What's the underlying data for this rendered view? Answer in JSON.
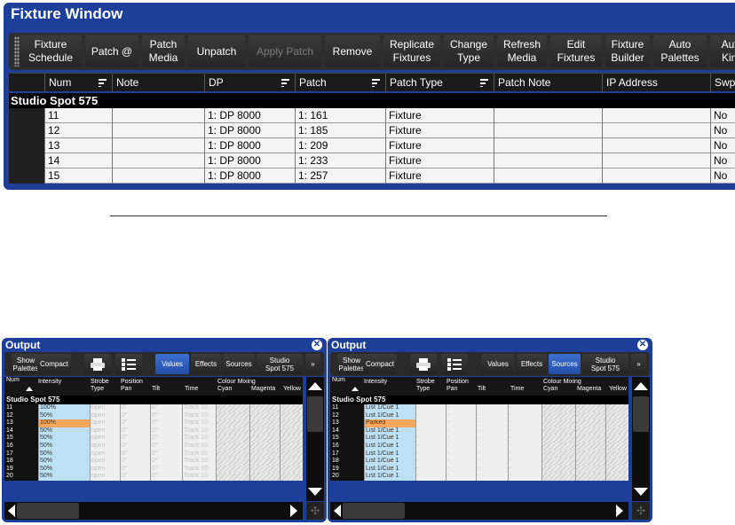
{
  "fixture_window": {
    "title": "Fixture Window",
    "toolbar": [
      {
        "label": "Fixture\nSchedule",
        "enabled": true
      },
      {
        "label": "Patch @",
        "enabled": true
      },
      {
        "label": "Patch\nMedia",
        "enabled": true
      },
      {
        "label": "Unpatch",
        "enabled": true
      },
      {
        "label": "Apply Patch",
        "enabled": false
      },
      {
        "label": "Remove",
        "enabled": true
      },
      {
        "label": "Replicate\nFixtures",
        "enabled": true
      },
      {
        "label": "Change\nType",
        "enabled": true
      },
      {
        "label": "Refresh\nMedia",
        "enabled": true
      },
      {
        "label": "Edit\nFixtures",
        "enabled": true
      },
      {
        "label": "Fixture\nBuilder",
        "enabled": true
      },
      {
        "label": "Auto\nPalettes",
        "enabled": true
      },
      {
        "label": "Auto\nKind",
        "enabled": true
      }
    ],
    "columns": [
      "Num",
      "Note",
      "DP",
      "Patch",
      "Patch Type",
      "Patch Note",
      "IP Address",
      "Swp"
    ],
    "group": "Studio Spot 575",
    "rows": [
      [
        "11",
        "",
        "1: DP 8000",
        "1: 161",
        "Fixture",
        "",
        "",
        "No"
      ],
      [
        "12",
        "",
        "1: DP 8000",
        "1: 185",
        "Fixture",
        "",
        "",
        "No"
      ],
      [
        "13",
        "",
        "1: DP 8000",
        "1: 209",
        "Fixture",
        "",
        "",
        "No"
      ],
      [
        "14",
        "",
        "1: DP 8000",
        "1: 233",
        "Fixture",
        "",
        "",
        "No"
      ],
      [
        "15",
        "",
        "1: DP 8000",
        "1: 257",
        "Fixture",
        "",
        "",
        "No"
      ]
    ]
  },
  "output_windows": [
    {
      "title": "Output",
      "toolbar": [
        "Show\nPalettes",
        "Compact",
        "",
        "",
        "Values",
        "Effects",
        "Sources",
        "Studio\nSpot 575",
        "»"
      ],
      "active_tab": "Values",
      "headers": [
        "Num",
        "Intensity",
        "Strobe\nType",
        "Position\nPan",
        "Tilt",
        "Time",
        "Colour Mixing\nCyan",
        "Magenta",
        "Yellow"
      ],
      "group": "Studio Spot 575",
      "rows": [
        {
          "num": "11",
          "value": "100%",
          "highlight": false
        },
        {
          "num": "12",
          "value": "50%",
          "highlight": false
        },
        {
          "num": "13",
          "value": "100%",
          "highlight": true
        },
        {
          "num": "14",
          "value": "50%",
          "highlight": false
        },
        {
          "num": "15",
          "value": "50%",
          "highlight": false
        },
        {
          "num": "16",
          "value": "50%",
          "highlight": false
        },
        {
          "num": "17",
          "value": "50%",
          "highlight": false
        },
        {
          "num": "18",
          "value": "50%",
          "highlight": false
        },
        {
          "num": "19",
          "value": "50%",
          "highlight": false
        },
        {
          "num": "20",
          "value": "50%",
          "highlight": false
        }
      ],
      "dim_cells": [
        "open",
        "0°",
        "0°",
        "Track 10"
      ]
    },
    {
      "title": "Output",
      "toolbar": [
        "Show\nPalettes",
        "Compact",
        "",
        "",
        "Values",
        "Effects",
        "Sources",
        "Studio\nSpot 575",
        "»"
      ],
      "active_tab": "Sources",
      "headers": [
        "Num",
        "Intensity",
        "Strobe\nType",
        "Position\nPan",
        "Tilt",
        "Time",
        "Colour Mixing\nCyan",
        "Magenta",
        "Yellow"
      ],
      "group": "Studio Spot 575",
      "rows": [
        {
          "num": "11",
          "value": "List 1/Cue 1",
          "highlight": false
        },
        {
          "num": "12",
          "value": "List 1/Cue 1",
          "highlight": false
        },
        {
          "num": "13",
          "value": "Parked",
          "highlight": true
        },
        {
          "num": "14",
          "value": "List 1/Cue 1",
          "highlight": false
        },
        {
          "num": "15",
          "value": "List 1/Cue 1",
          "highlight": false
        },
        {
          "num": "16",
          "value": "List 1/Cue 1",
          "highlight": false
        },
        {
          "num": "17",
          "value": "List 1/Cue 1",
          "highlight": false
        },
        {
          "num": "18",
          "value": "List 1/Cue 1",
          "highlight": false
        },
        {
          "num": "19",
          "value": "List 1/Cue 1",
          "highlight": false
        },
        {
          "num": "20",
          "value": "List 1/Cue 1",
          "highlight": false
        }
      ],
      "dim_cells": [
        "-",
        "-",
        "-",
        "-"
      ]
    }
  ],
  "colors": {
    "window_blue": "#1d3f9a",
    "active_tab": "#2f5fc4",
    "intensity": "#bde0f5",
    "highlight": "#f8a65c"
  }
}
